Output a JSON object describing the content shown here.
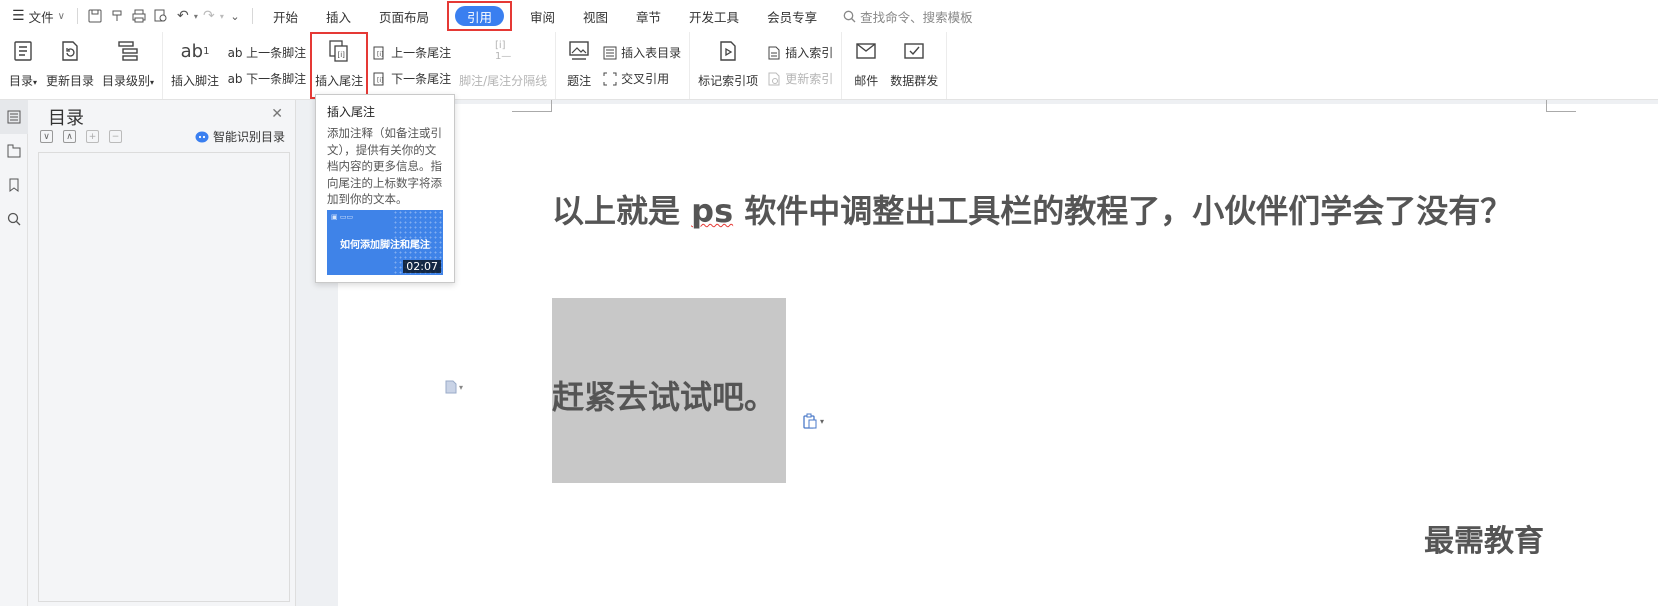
{
  "menubar": {
    "file_label": "文件",
    "tabs": [
      {
        "label": "开始"
      },
      {
        "label": "插入"
      },
      {
        "label": "页面布局"
      },
      {
        "label": "引用"
      },
      {
        "label": "审阅"
      },
      {
        "label": "视图"
      },
      {
        "label": "章节"
      },
      {
        "label": "开发工具"
      },
      {
        "label": "会员专享"
      }
    ],
    "search_placeholder": "查找命令、搜索模板"
  },
  "ribbon": {
    "toc": "目录",
    "update_toc": "更新目录",
    "toc_level": "目录级别",
    "insert_footnote": "插入脚注",
    "prev_footnote": "上一条脚注",
    "next_footnote": "下一条脚注",
    "insert_endnote": "插入尾注",
    "prev_endnote": "上一条尾注",
    "next_endnote": "下一条尾注",
    "separator": "脚注/尾注分隔线",
    "caption": "题注",
    "insert_table_toc": "插入表目录",
    "cross_ref": "交叉引用",
    "mark_index": "标记索引项",
    "insert_index": "插入索引",
    "update_index": "更新索引",
    "mail": "邮件",
    "mail_merge": "数据群发"
  },
  "toc_panel": {
    "title": "目录",
    "smart_label": "智能识别目录"
  },
  "tooltip": {
    "title": "插入尾注",
    "description": "添加注释（如备注或引文），提供有关你的文档内容的更多信息。指向尾注的上标数字将添加到你的文本。",
    "thumb_caption": "如何添加脚注和尾注",
    "duration": "02:07"
  },
  "document": {
    "line1_before": "以上就是 ",
    "line1_ps": "ps",
    "line1_after": " 软件中调整出工具栏的教程了，小伙伴们学会了没有？",
    "line2": "赶紧去试试吧。",
    "watermark": "最需教育"
  },
  "colors": {
    "accent": "#3a7ff0",
    "highlight": "#e53935"
  }
}
